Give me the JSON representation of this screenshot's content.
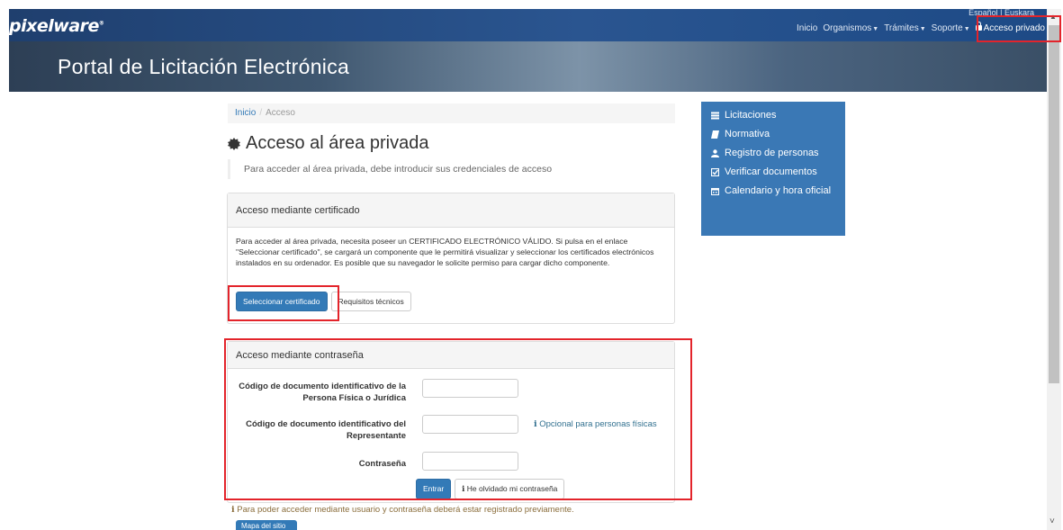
{
  "brand": {
    "name": "pixelware",
    "mark": "®"
  },
  "language": "Español | Euskara",
  "nav": {
    "inicio": "Inicio",
    "organismos": "Organismos",
    "tramites": "Trámites",
    "soporte": "Soporte",
    "acceso_privado": "Acceso privado"
  },
  "banner": {
    "title": "Portal de Licitación Electrónica"
  },
  "breadcrumb": {
    "home": "Inicio",
    "separator": "/",
    "current": "Acceso"
  },
  "heading": "Acceso al área privada",
  "intro": "Para acceder al área privada, debe introducir sus credenciales de acceso",
  "cert_panel": {
    "title": "Acceso mediante certificado",
    "text": "Para acceder al área privada, necesita poseer un CERTIFICADO ELECTRÓNICO VÁLIDO. Si pulsa en el enlace \"Seleccionar certificado\", se cargará un componente que le permitirá visualizar y seleccionar los certificados electrónicos instalados en su ordenador. Es posible que su navegador le solicite permiso para cargar dicho componente.",
    "select_button": "Seleccionar certificado",
    "requirements_button": "Requisitos técnicos"
  },
  "password_panel": {
    "title": "Acceso mediante contraseña",
    "doc_label": "Código de documento identificativo de la Persona Física o Jurídica",
    "rep_label": "Código de documento identificativo del Representante",
    "rep_hint": "Opcional para personas físicas",
    "password_label": "Contraseña",
    "doc_value": "",
    "rep_value": "",
    "password_value": "",
    "enter_button": "Entrar",
    "forgot_button": "He olvidado mi contraseña"
  },
  "register_note": "Para poder acceder mediante usuario y contraseña deberá estar registrado previamente.",
  "sitemap_button": "Mapa del sitio",
  "side_menu": [
    {
      "label": "Licitaciones",
      "icon": "list-icon"
    },
    {
      "label": "Normativa",
      "icon": "book-icon"
    },
    {
      "label": "Registro de personas",
      "icon": "user-icon"
    },
    {
      "label": "Verificar documentos",
      "icon": "checkbox-icon"
    },
    {
      "label": "Calendario y hora oficial",
      "icon": "calendar-icon"
    }
  ],
  "colors": {
    "navbar": "#2a5590",
    "primary": "#337ab7",
    "side_menu": "#3a78b5",
    "highlight": "#e3242b",
    "warning_text": "#8a6d3b",
    "info_text": "#31708f"
  }
}
